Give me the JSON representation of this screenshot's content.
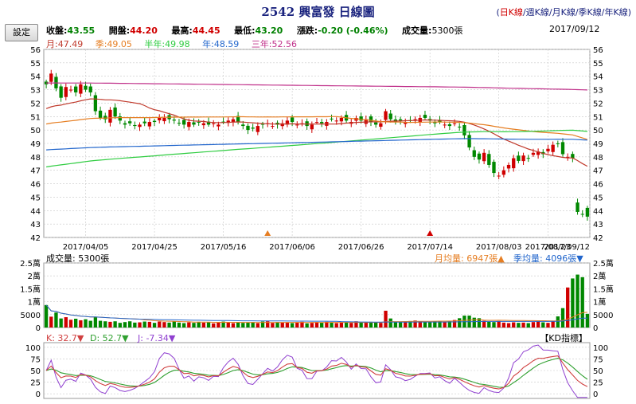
{
  "header": {
    "title": "2542 興富發 日線圖",
    "periods": [
      {
        "label": "日K線",
        "active": true
      },
      {
        "label": "週K線",
        "active": false
      },
      {
        "label": "月K線",
        "active": false
      },
      {
        "label": "季K線",
        "active": false
      },
      {
        "label": "年K線",
        "active": false
      }
    ],
    "settings_label": "設定",
    "date": "2017/09/12"
  },
  "quote": {
    "close_label": "收盤:",
    "close": "43.55",
    "open_label": "開盤:",
    "open": "44.20",
    "high_label": "最高:",
    "high": "44.45",
    "low_label": "最低:",
    "low": "43.20",
    "change_label": "漲跌:",
    "change": "-0.20 (-0.46%)",
    "volume_label": "成交量:",
    "volume": "5300張"
  },
  "ma_legend": [
    {
      "label": "月:47.49",
      "color": "#c0392b"
    },
    {
      "label": "季:49.05",
      "color": "#e67e22"
    },
    {
      "label": "半年:49.98",
      "color": "#2ecc40"
    },
    {
      "label": "年:48.59",
      "color": "#2266cc"
    },
    {
      "label": "三年:52.56",
      "color": "#c0308a"
    }
  ],
  "colors": {
    "up": "#d00000",
    "down": "#008800",
    "grid": "#c8c8c8",
    "kline": "#d04040",
    "dline": "#30a030",
    "jline": "#9040d0"
  },
  "chart_data": [
    {
      "type": "candlestick",
      "xlabels": [
        "2017/04/05",
        "2017/04/25",
        "2017/05/16",
        "2017/06/06",
        "2017/06/26",
        "2017/07/14",
        "2017/08/03",
        "2017/08/23",
        "2017/09/12"
      ],
      "ylim": [
        42,
        56
      ],
      "yticks": [
        42,
        43,
        44,
        45,
        46,
        47,
        48,
        49,
        50,
        51,
        52,
        53,
        54,
        55,
        56
      ],
      "grid": true,
      "closes": [
        53.4,
        54.2,
        53.1,
        52.4,
        53.2,
        53.0,
        52.8,
        53.4,
        53.0,
        52.8,
        51.4,
        50.9,
        50.8,
        51.5,
        51.0,
        50.7,
        50.4,
        50.5,
        50.3,
        50.4,
        50.5,
        50.6,
        50.6,
        50.9,
        50.9,
        50.8,
        50.7,
        50.5,
        50.4,
        50.6,
        50.4,
        50.6,
        50.5,
        50.4,
        50.5,
        50.4,
        50.6,
        50.7,
        50.8,
        50.6,
        50.3,
        50.0,
        50.1,
        50.3,
        50.4,
        50.5,
        50.3,
        50.4,
        50.5,
        50.7,
        50.6,
        50.4,
        50.5,
        50.3,
        50.4,
        50.6,
        50.5,
        50.6,
        50.8,
        50.7,
        50.9,
        50.7,
        50.6,
        50.9,
        50.7,
        50.8,
        50.6,
        50.4,
        50.5,
        51.4,
        50.8,
        50.6,
        50.7,
        50.6,
        50.7,
        50.8,
        50.9,
        50.9,
        50.7,
        50.5,
        50.6,
        50.4,
        50.3,
        50.5,
        50.2,
        49.6,
        48.7,
        48.0,
        47.8,
        48.3,
        47.4,
        46.8,
        46.6,
        47.0,
        47.4,
        47.9,
        47.7,
        48.1,
        47.9,
        48.3,
        48.4,
        48.2,
        48.6,
        48.9,
        49.0,
        48.2,
        48.0,
        47.9,
        43.9,
        43.75,
        43.55
      ],
      "volume": {
        "ylim": [
          0,
          25000
        ],
        "yticks": [
          "0",
          "5000",
          "1萬",
          "1.5萬",
          "2萬",
          "2.5萬"
        ],
        "title": "成交量: 5300張",
        "ma_month": "月均量: 6947張▲",
        "ma_season": "季均量: 4096張▼",
        "values": [
          8700,
          4200,
          5800,
          3500,
          4000,
          3000,
          3400,
          2800,
          3200,
          2600,
          4100,
          2600,
          2400,
          2200,
          2400,
          1800,
          2100,
          2400,
          1900,
          2000,
          2300,
          2200,
          1800,
          2300,
          2100,
          1900,
          2400,
          1900,
          1700,
          2000,
          1800,
          2200,
          1900,
          2000,
          1600,
          1900,
          2300,
          2100,
          1700,
          1900,
          1800,
          2000,
          2100,
          1700,
          2300,
          2400,
          1800,
          2100,
          2000,
          1900,
          1700,
          2000,
          2200,
          1600,
          1800,
          2100,
          1900,
          2200,
          2000,
          1700,
          1900,
          2100,
          1800,
          2400,
          2000,
          1900,
          2200,
          2000,
          1800,
          6500,
          3500,
          2200,
          2100,
          2200,
          2500,
          2700,
          2300,
          2100,
          2000,
          2400,
          2600,
          2200,
          2600,
          2900,
          3600,
          4600,
          4600,
          3800,
          3600,
          2600,
          2200,
          2100,
          2500,
          1900,
          1700,
          2000,
          1800,
          1900,
          1700,
          2100,
          2300,
          2000,
          1800,
          2600,
          4300,
          7500,
          15500,
          19000,
          20500,
          19500,
          5300
        ]
      }
    },
    {
      "type": "line",
      "title": "KD指標",
      "ylim": [
        -10,
        110
      ],
      "yticks": [
        0,
        25,
        50,
        75,
        100
      ],
      "series": [
        {
          "name": "K",
          "label": "K: 32.7▼"
        },
        {
          "name": "D",
          "label": "D: 52.7▼"
        },
        {
          "name": "J",
          "label": "J: -7.34▼"
        }
      ]
    }
  ]
}
